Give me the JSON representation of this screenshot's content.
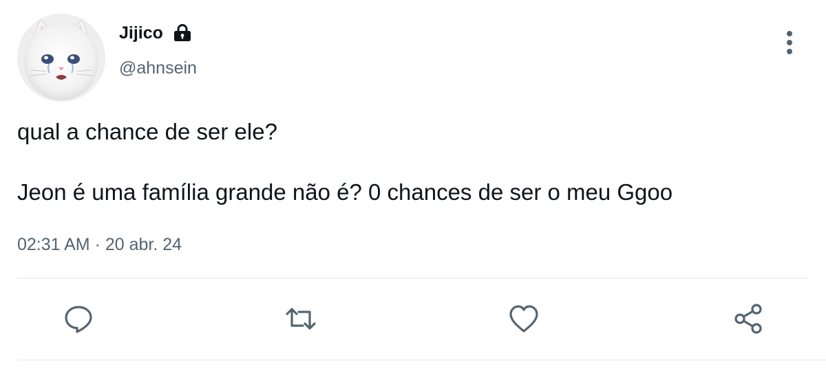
{
  "tweet": {
    "author": {
      "display_name": "Jijico",
      "handle": "@ahnsein",
      "protected_icon": "lock-icon",
      "avatar_icon": "crying-cat-avatar"
    },
    "text_lines": [
      "qual a chance de ser ele?",
      "Jeon é uma família grande não é? 0 chances de ser o meu Ggoo"
    ],
    "time": "02:31 AM",
    "separator": "·",
    "date": "20 abr. 24"
  },
  "menu_icon": "more-vertical-icon",
  "actions": [
    {
      "name": "reply",
      "icon": "reply-icon"
    },
    {
      "name": "retweet",
      "icon": "retweet-icon"
    },
    {
      "name": "like",
      "icon": "heart-icon"
    },
    {
      "name": "share",
      "icon": "share-icon"
    }
  ],
  "colors": {
    "text_primary": "#0f1419",
    "text_secondary": "#536471",
    "divider": "#eff3f4",
    "icon": "#536471"
  }
}
